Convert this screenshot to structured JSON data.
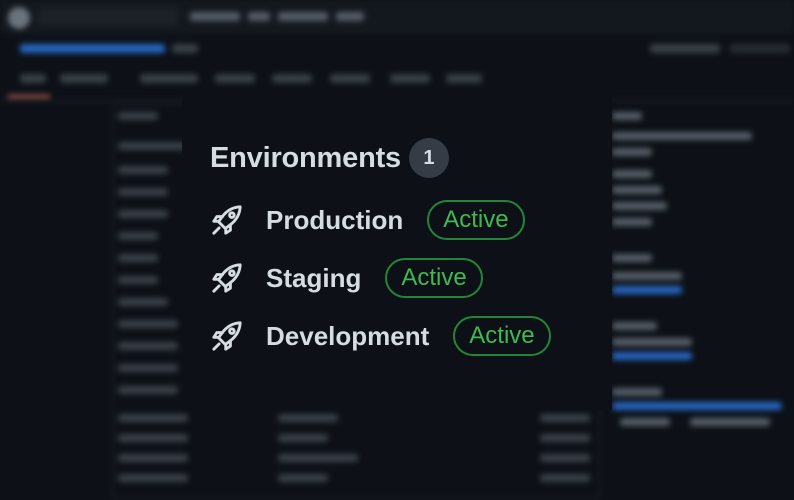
{
  "environments": {
    "title": "Environments",
    "count": "1",
    "items": [
      {
        "name": "Production",
        "status": "Active",
        "icon": "rocket-icon"
      },
      {
        "name": "Staging",
        "status": "Active",
        "icon": "rocket-icon"
      },
      {
        "name": "Development",
        "status": "Active",
        "icon": "rocket-icon"
      }
    ]
  },
  "colors": {
    "background": "#0d1117",
    "text": "#d6dce3",
    "counter_bg": "#363c45",
    "badge_border": "#238636",
    "badge_text": "#3fb950"
  }
}
